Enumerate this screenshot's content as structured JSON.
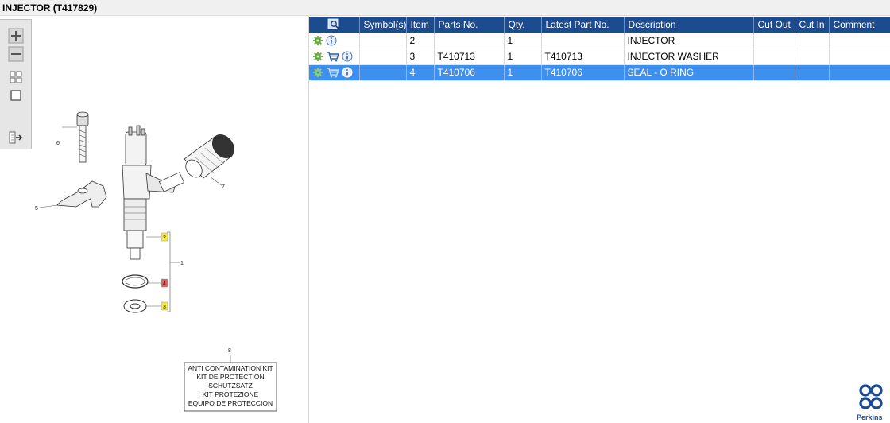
{
  "window": {
    "title": "INJECTOR (T417829)"
  },
  "toolbar": {
    "buttons": [
      {
        "name": "zoom-in",
        "icon": "plus-icon"
      },
      {
        "name": "zoom-out",
        "icon": "minus-icon"
      },
      {
        "name": "fit-all",
        "icon": "grid-icon"
      },
      {
        "name": "fit-window",
        "icon": "square-icon"
      },
      {
        "name": "export",
        "icon": "export-arrow-icon"
      }
    ]
  },
  "drawing": {
    "callouts": {
      "c1": "1",
      "c2": "2",
      "c3": "3",
      "c4": "4",
      "c5": "5",
      "c6": "6",
      "c7": "7",
      "c8": "8"
    },
    "kit_lines": [
      "ANTI CONTAMINATION KIT",
      "KIT DE PROTECTION",
      "SCHUTZSATZ",
      "KIT PROTEZIONE",
      "EQUIPO DE PROTECCION"
    ]
  },
  "table": {
    "columns": [
      "Symbol(s)",
      "Item",
      "Parts No.",
      "Qty.",
      "Latest Part No.",
      "Description",
      "Cut Out",
      "Cut In",
      "Comment"
    ],
    "rows": [
      {
        "icons": [
          "gear-icon",
          "info-icon"
        ],
        "symbol": "",
        "item": "2",
        "part_no": "",
        "qty": "1",
        "latest_part_no": "",
        "description": "INJECTOR",
        "cut_out": "",
        "cut_in": "",
        "comment": ""
      },
      {
        "icons": [
          "gear-icon",
          "cart-icon",
          "info-icon"
        ],
        "symbol": "",
        "item": "3",
        "part_no": "T410713",
        "qty": "1",
        "latest_part_no": "T410713",
        "description": "INJECTOR WASHER",
        "cut_out": "",
        "cut_in": "",
        "comment": ""
      },
      {
        "icons": [
          "gear-icon",
          "cart-icon",
          "info-icon"
        ],
        "symbol": "",
        "item": "4",
        "part_no": "T410706",
        "qty": "1",
        "latest_part_no": "T410706",
        "description": "SEAL - O RING",
        "cut_out": "",
        "cut_in": "",
        "comment": "",
        "selected": true
      }
    ]
  },
  "brand": {
    "name": "Perkins",
    "color": "#1d4b8f"
  },
  "colors": {
    "header_bg": "#1d4b8f",
    "selected_row": "#3d8ff0",
    "callout_yellow": "#f5ea3a",
    "callout_red": "#e06060"
  }
}
